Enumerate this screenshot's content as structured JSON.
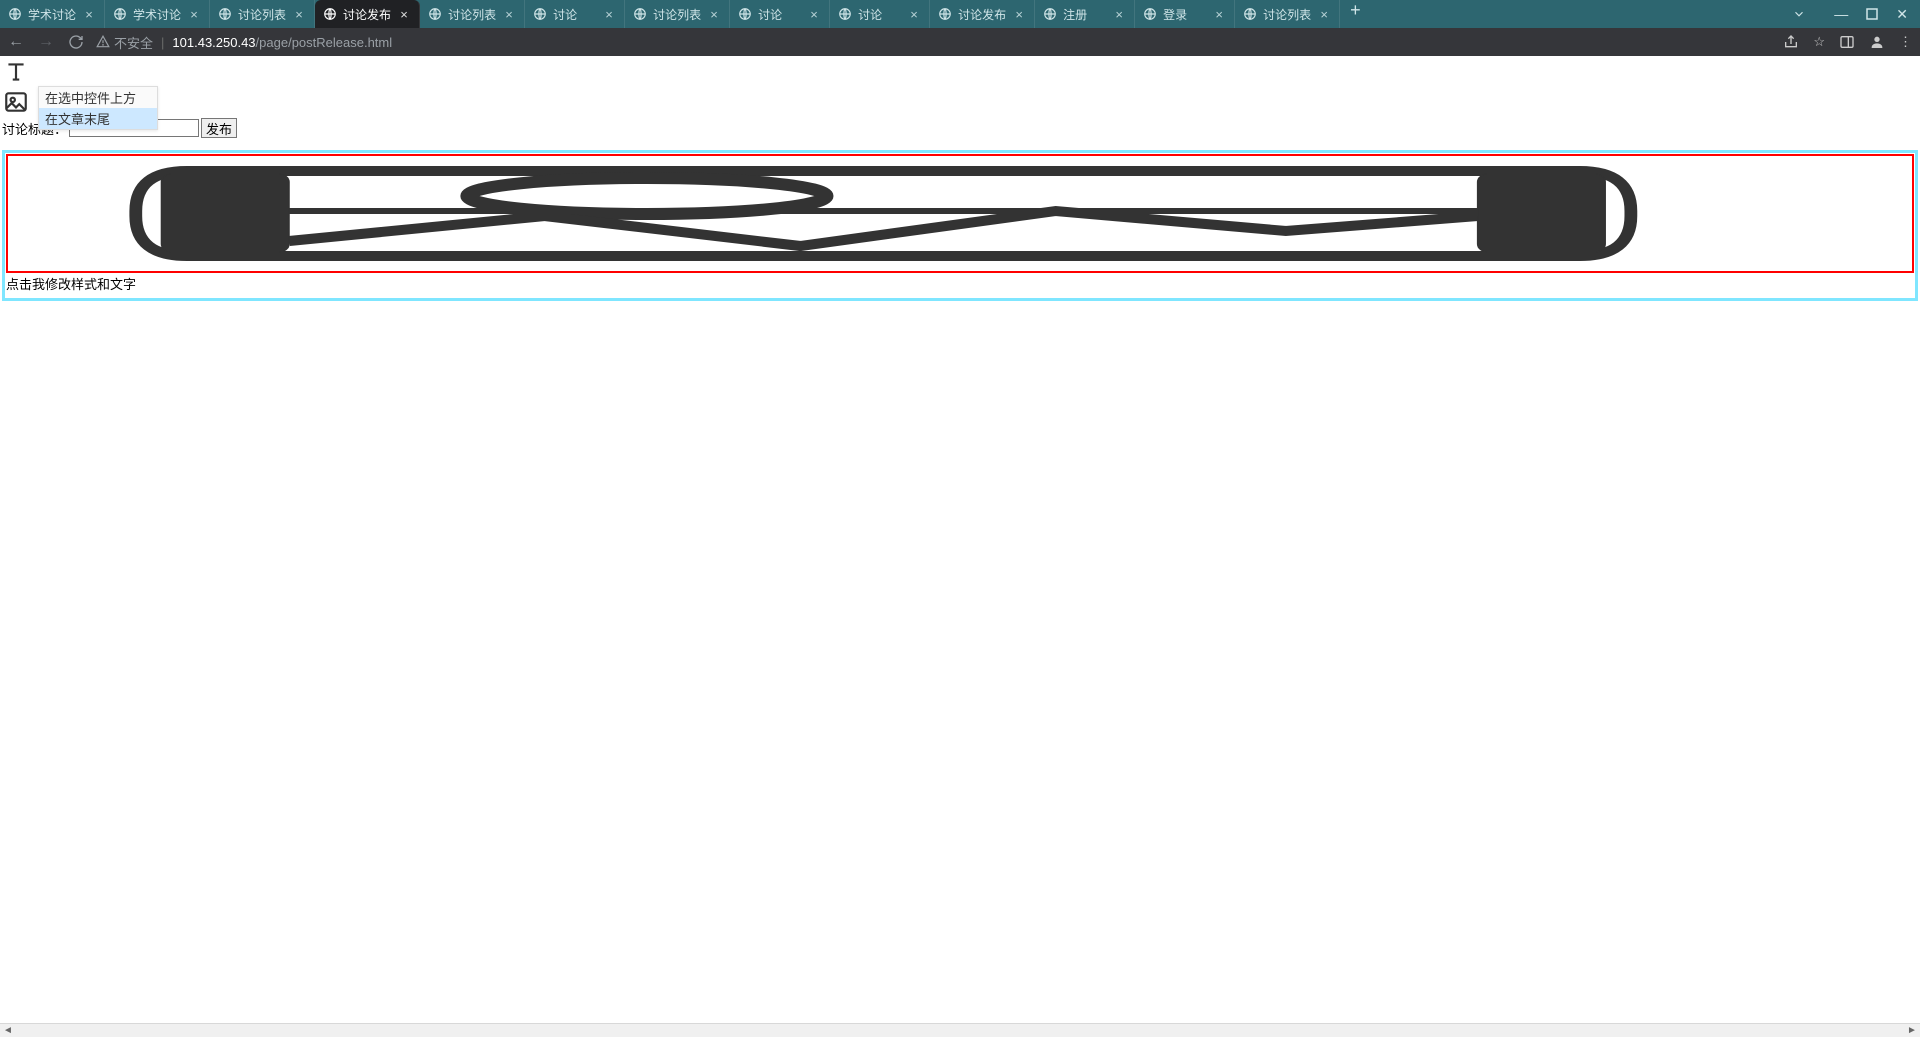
{
  "browser": {
    "tabs": [
      {
        "title": "学术讨论",
        "active": false
      },
      {
        "title": "学术讨论",
        "active": false
      },
      {
        "title": "讨论列表",
        "active": false
      },
      {
        "title": "讨论发布",
        "active": true
      },
      {
        "title": "讨论列表",
        "active": false
      },
      {
        "title": "讨论",
        "active": false
      },
      {
        "title": "讨论列表",
        "active": false
      },
      {
        "title": "讨论",
        "active": false
      },
      {
        "title": "讨论",
        "active": false
      },
      {
        "title": "讨论发布",
        "active": false
      },
      {
        "title": "注册",
        "active": false
      },
      {
        "title": "登录",
        "active": false
      },
      {
        "title": "讨论列表",
        "active": false
      }
    ],
    "insecure_label": "不安全",
    "url_host": "101.43.250.43",
    "url_path": "/page/postRelease.html"
  },
  "page": {
    "dropdown": {
      "option_above": "在选中控件上方",
      "option_end": "在文章末尾"
    },
    "title_label": "讨论标题：",
    "title_value": "",
    "publish_button": "发布",
    "editable_text": "点击我修改样式和文字"
  }
}
